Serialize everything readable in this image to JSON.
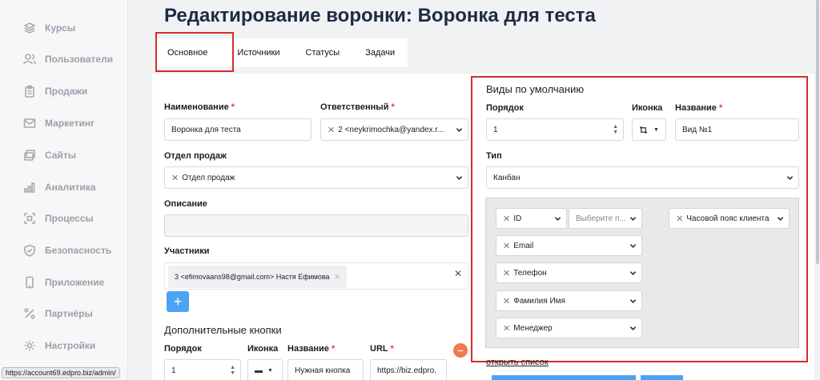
{
  "sidebar": {
    "items": [
      {
        "label": "Курсы",
        "icon": "layers-icon"
      },
      {
        "label": "Пользователи",
        "icon": "users-icon"
      },
      {
        "label": "Продажи",
        "icon": "clipboard-icon"
      },
      {
        "label": "Маркетинг",
        "icon": "mail-icon"
      },
      {
        "label": "Сайты",
        "icon": "windows-icon"
      },
      {
        "label": "Аналитика",
        "icon": "bar-chart-icon"
      },
      {
        "label": "Процессы",
        "icon": "process-icon"
      },
      {
        "label": "Безопасность",
        "icon": "shield-icon"
      },
      {
        "label": "Приложение",
        "icon": "phone-icon"
      },
      {
        "label": "Партнёры",
        "icon": "percent-icon"
      },
      {
        "label": "Настройки",
        "icon": "gear-icon"
      }
    ]
  },
  "statusbar": {
    "url": "https://account69.edpro.biz/admin/"
  },
  "page": {
    "title": "Редактирование воронки: Воронка для теста"
  },
  "tabs": [
    {
      "label": "Основное",
      "active": true
    },
    {
      "label": "Источники"
    },
    {
      "label": "Статусы"
    },
    {
      "label": "Задачи"
    }
  ],
  "form": {
    "name_label": "Наименование",
    "name_value": "Воронка для теста",
    "responsible_label": "Ответственный",
    "responsible_value": "2 <neykrimochka@yandex.r...",
    "dept_label": "Отдел продаж",
    "dept_value": "Отдел продаж",
    "description_label": "Описание",
    "description_value": "",
    "participants_label": "Участники",
    "participants": [
      "3 <efimovaans98@gmail.com> Настя Ефимова"
    ],
    "required_mark": "*",
    "extra_buttons_title": "Дополнительные кнопки",
    "extra": {
      "order_label": "Порядок",
      "order_value": "1",
      "icon_label": "Иконка",
      "name_label": "Название",
      "name_value": "Нужная кнопка",
      "url_label": "URL",
      "url_value": "https://biz.edpro."
    }
  },
  "views": {
    "title": "Виды по умолчанию",
    "order_label": "Порядок",
    "order_value": "1",
    "icon_label": "Иконка",
    "name_label": "Название",
    "name_value": "Вид №1",
    "type_label": "Тип",
    "type_value": "Канбан",
    "columns": [
      {
        "label": "ID"
      },
      {
        "label": "Email"
      },
      {
        "label": "Телефон"
      },
      {
        "label": "Фамилия Имя"
      },
      {
        "label": "Менеджер"
      }
    ],
    "select_placeholder": "Выберите п...",
    "timezone_column": "Часовой пояс клиента",
    "open_list_link": "открыть список"
  },
  "colors": {
    "accent": "#4aa3f3",
    "highlight": "#d62b2b",
    "required": "#e23b3b",
    "danger_btn": "#f07a50"
  }
}
